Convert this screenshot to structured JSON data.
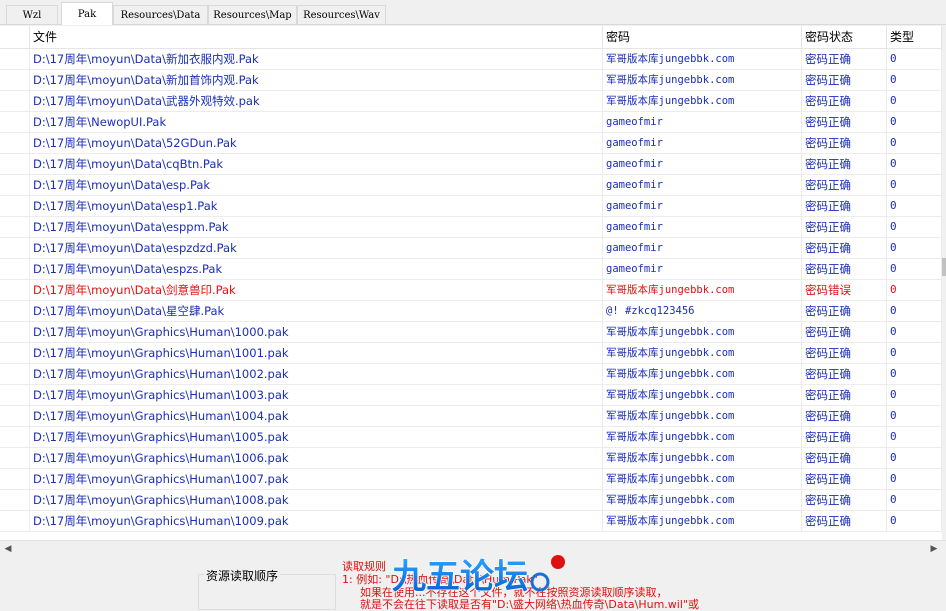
{
  "tabs": [
    {
      "label": "Wzl",
      "active": false
    },
    {
      "label": "Pak",
      "active": true
    },
    {
      "label": "Resources\\Data",
      "active": false
    },
    {
      "label": "Resources\\Map",
      "active": false
    },
    {
      "label": "Resources\\Wav",
      "active": false
    }
  ],
  "table": {
    "headers": {
      "file": "文件",
      "password": "密码",
      "status": "密码状态",
      "type": "类型"
    },
    "rows": [
      {
        "file": "D:\\17周年\\moyun\\Data\\新加衣服内观.Pak",
        "password": "军哥版本库jungebbk.com",
        "status": "密码正确",
        "type": "0",
        "error": false
      },
      {
        "file": "D:\\17周年\\moyun\\Data\\新加首饰内观.Pak",
        "password": "军哥版本库jungebbk.com",
        "status": "密码正确",
        "type": "0",
        "error": false
      },
      {
        "file": "D:\\17周年\\moyun\\Data\\武器外观特效.pak",
        "password": "军哥版本库jungebbk.com",
        "status": "密码正确",
        "type": "0",
        "error": false
      },
      {
        "file": "D:\\17周年\\NewopUI.Pak",
        "password": "gameofmir",
        "status": "密码正确",
        "type": "0",
        "error": false
      },
      {
        "file": "D:\\17周年\\moyun\\Data\\52GDun.Pak",
        "password": "gameofmir",
        "status": "密码正确",
        "type": "0",
        "error": false
      },
      {
        "file": "D:\\17周年\\moyun\\Data\\cqBtn.Pak",
        "password": "gameofmir",
        "status": "密码正确",
        "type": "0",
        "error": false
      },
      {
        "file": "D:\\17周年\\moyun\\Data\\esp.Pak",
        "password": "gameofmir",
        "status": "密码正确",
        "type": "0",
        "error": false
      },
      {
        "file": "D:\\17周年\\moyun\\Data\\esp1.Pak",
        "password": "gameofmir",
        "status": "密码正确",
        "type": "0",
        "error": false
      },
      {
        "file": "D:\\17周年\\moyun\\Data\\esppm.Pak",
        "password": "gameofmir",
        "status": "密码正确",
        "type": "0",
        "error": false
      },
      {
        "file": "D:\\17周年\\moyun\\Data\\espzdzd.Pak",
        "password": "gameofmir",
        "status": "密码正确",
        "type": "0",
        "error": false
      },
      {
        "file": "D:\\17周年\\moyun\\Data\\espzs.Pak",
        "password": "gameofmir",
        "status": "密码正确",
        "type": "0",
        "error": false
      },
      {
        "file": "D:\\17周年\\moyun\\Data\\剑意兽印.Pak",
        "password": "军哥版本库jungebbk.com",
        "status": "密码错误",
        "type": "0",
        "error": true
      },
      {
        "file": "D:\\17周年\\moyun\\Data\\星空肆.Pak",
        "password": "@! #zkcq123456",
        "status": "密码正确",
        "type": "0",
        "error": false
      },
      {
        "file": "D:\\17周年\\moyun\\Graphics\\Human\\1000.pak",
        "password": "军哥版本库jungebbk.com",
        "status": "密码正确",
        "type": "0",
        "error": false
      },
      {
        "file": "D:\\17周年\\moyun\\Graphics\\Human\\1001.pak",
        "password": "军哥版本库jungebbk.com",
        "status": "密码正确",
        "type": "0",
        "error": false
      },
      {
        "file": "D:\\17周年\\moyun\\Graphics\\Human\\1002.pak",
        "password": "军哥版本库jungebbk.com",
        "status": "密码正确",
        "type": "0",
        "error": false
      },
      {
        "file": "D:\\17周年\\moyun\\Graphics\\Human\\1003.pak",
        "password": "军哥版本库jungebbk.com",
        "status": "密码正确",
        "type": "0",
        "error": false
      },
      {
        "file": "D:\\17周年\\moyun\\Graphics\\Human\\1004.pak",
        "password": "军哥版本库jungebbk.com",
        "status": "密码正确",
        "type": "0",
        "error": false
      },
      {
        "file": "D:\\17周年\\moyun\\Graphics\\Human\\1005.pak",
        "password": "军哥版本库jungebbk.com",
        "status": "密码正确",
        "type": "0",
        "error": false
      },
      {
        "file": "D:\\17周年\\moyun\\Graphics\\Human\\1006.pak",
        "password": "军哥版本库jungebbk.com",
        "status": "密码正确",
        "type": "0",
        "error": false
      },
      {
        "file": "D:\\17周年\\moyun\\Graphics\\Human\\1007.pak",
        "password": "军哥版本库jungebbk.com",
        "status": "密码正确",
        "type": "0",
        "error": false
      },
      {
        "file": "D:\\17周年\\moyun\\Graphics\\Human\\1008.pak",
        "password": "军哥版本库jungebbk.com",
        "status": "密码正确",
        "type": "0",
        "error": false
      },
      {
        "file": "D:\\17周年\\moyun\\Graphics\\Human\\1009.pak",
        "password": "军哥版本库jungebbk.com",
        "status": "密码正确",
        "type": "0",
        "error": false
      }
    ]
  },
  "bottom": {
    "order_title": "资源读取顺序",
    "rules_title": "读取规则",
    "rule_line1": "1: 例如: \"D:\\热血传奇\\Data\\Hum.Pak\"",
    "rule_line2": "如果在使用...不存在这个文件，就不在按照资源读取顺序读取，",
    "rule_line3": "就是不会在往下读取是否有\"D:\\盛大网络\\热血传奇\\Data\\Hum.wil\"或",
    "logo_text": "九五论坛"
  },
  "colors": {
    "text_blue": "#1a2db8",
    "text_error": "#e01010"
  }
}
